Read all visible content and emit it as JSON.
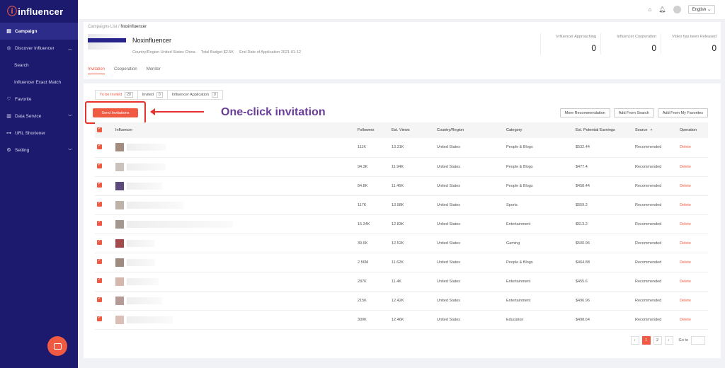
{
  "brand": {
    "logo_text": "influencer",
    "logo_mark": "n"
  },
  "sidebar": {
    "items": [
      {
        "label": "Campaign",
        "icon": "document-icon",
        "active": true
      },
      {
        "label": "Discover Influencer",
        "icon": "compass-icon",
        "expanded": true
      },
      {
        "label": "Search",
        "sub": true
      },
      {
        "label": "Influencer Exact Match",
        "sub": true
      },
      {
        "label": "Favorite",
        "icon": "heart-icon"
      },
      {
        "label": "Data Service",
        "icon": "chart-icon",
        "chevron": true
      },
      {
        "label": "URL Shortener",
        "icon": "link-icon"
      },
      {
        "label": "Setting",
        "icon": "gear-icon",
        "chevron": true
      }
    ]
  },
  "topbar": {
    "language": "English",
    "language_caret": "⌄"
  },
  "breadcrumb": {
    "parent": "Campaigns List",
    "separator": "/",
    "current": "Noxinfluencer"
  },
  "campaign": {
    "name": "Noxinfluencer",
    "country_label": "Country/Region",
    "country_value": "United States  China",
    "budget_label": "Total Budget",
    "budget_value": "$2.5K",
    "end_label": "End Date of Application",
    "end_value": "2021-01-12"
  },
  "stats": [
    {
      "label": "Influencer Approaching",
      "value": "0"
    },
    {
      "label": "Influencer Cooperation",
      "value": "0"
    },
    {
      "label": "Video has been Released",
      "value": "0"
    }
  ],
  "main_tabs": [
    "Invitation",
    "Cooperation",
    "Monitor"
  ],
  "sub_tabs": [
    {
      "label": "To be Invited",
      "count": "20"
    },
    {
      "label": "Invited",
      "count": "0"
    },
    {
      "label": "Influencer Application",
      "count": "0"
    }
  ],
  "send_button": "Send Invitations",
  "annotation": "One-click invitation",
  "action_buttons": [
    "More Recommendation",
    "Add From Search",
    "Add From My Favorites"
  ],
  "table": {
    "headers": [
      "Influencer",
      "Followers",
      "Est. Views",
      "Country/Region",
      "Category",
      "Est. Potential Earnings",
      "Source",
      "Operation"
    ],
    "rows": [
      {
        "followers": "111K",
        "views": "13.31K",
        "country": "United States",
        "category": "People & Blogs",
        "earnings": "$532.44",
        "source": "Recommended",
        "op": "Delete"
      },
      {
        "followers": "94.3K",
        "views": "11.94K",
        "country": "United States",
        "category": "People & Blogs",
        "earnings": "$477.4",
        "source": "Recommended",
        "op": "Delete"
      },
      {
        "followers": "84.8K",
        "views": "11.46K",
        "country": "United States",
        "category": "People & Blogs",
        "earnings": "$458.44",
        "source": "Recommended",
        "op": "Delete"
      },
      {
        "followers": "117K",
        "views": "13.98K",
        "country": "United States",
        "category": "Sports",
        "earnings": "$559.2",
        "source": "Recommended",
        "op": "Delete"
      },
      {
        "followers": "15.34K",
        "views": "12.83K",
        "country": "United States",
        "category": "Entertainment",
        "earnings": "$513.2",
        "source": "Recommended",
        "op": "Delete"
      },
      {
        "followers": "39.6K",
        "views": "12.52K",
        "country": "United States",
        "category": "Gaming",
        "earnings": "$500.96",
        "source": "Recommended",
        "op": "Delete"
      },
      {
        "followers": "2.56M",
        "views": "11.62K",
        "country": "United States",
        "category": "People & Blogs",
        "earnings": "$464.88",
        "source": "Recommended",
        "op": "Delete"
      },
      {
        "followers": "287K",
        "views": "11.4K",
        "country": "United States",
        "category": "Entertainment",
        "earnings": "$455.6",
        "source": "Recommended",
        "op": "Delete"
      },
      {
        "followers": "215K",
        "views": "12.42K",
        "country": "United States",
        "category": "Entertainment",
        "earnings": "$496.96",
        "source": "Recommended",
        "op": "Delete"
      },
      {
        "followers": "300K",
        "views": "12.46K",
        "country": "United States",
        "category": "Education",
        "earnings": "$498.64",
        "source": "Recommended",
        "op": "Delete"
      }
    ],
    "swatch_colors": [
      "#a38d80",
      "#c9c2bd",
      "#5b4a7a",
      "#bdb2a8",
      "#a39890",
      "#a54a4a",
      "#9e8a7e",
      "#d6b7ae",
      "#b59a95",
      "#d9bfb5"
    ]
  },
  "pagination": {
    "prev": "‹",
    "pages": [
      "1",
      "2"
    ],
    "next": "›",
    "goto_label": "Go to"
  },
  "colors": {
    "accent": "#f05a42",
    "sidebar": "#1c1a6e",
    "annotation": "#6a3d9a",
    "highlight": "#e5322f"
  }
}
